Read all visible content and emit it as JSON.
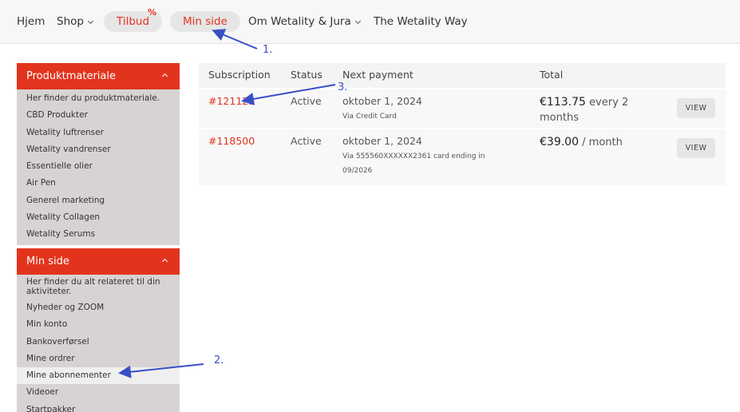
{
  "nav": {
    "items": [
      {
        "label": "Hjem"
      },
      {
        "label": "Shop"
      },
      {
        "label": "Tilbud"
      },
      {
        "label": "Min side"
      },
      {
        "label": "Om Wetality & Jura"
      },
      {
        "label": "The Wetality Way"
      }
    ],
    "tilbud_badge": "%"
  },
  "sidebar": {
    "sections": [
      {
        "title": "Produktmateriale",
        "items": [
          "Her finder du produktmateriale.",
          "CBD Produkter",
          "Wetality luftrenser",
          "Wetality vandrenser",
          "Essentielle olier",
          "Air Pen",
          "Generel marketing",
          "Wetality Collagen",
          "Wetality Serums"
        ]
      },
      {
        "title": "Min side",
        "items": [
          "Her finder du alt relateret til din aktiviteter.",
          "Nyheder og ZOOM",
          "Min konto",
          "Bankoverførsel",
          "Mine ordrer",
          "Mine abonnementer",
          "Videoer",
          "Startpakker"
        ]
      }
    ]
  },
  "table": {
    "headers": [
      "Subscription",
      "Status",
      "Next payment",
      "Total"
    ],
    "rows": [
      {
        "id": "#121121",
        "status": "Active",
        "next_payment": "oktober 1, 2024",
        "method": "Via Credit Card",
        "amount": "€113.75",
        "period": "every 2 months",
        "action": "VIEW"
      },
      {
        "id": "#118500",
        "status": "Active",
        "next_payment": "oktober 1, 2024",
        "method": "Via 555560XXXXXX2361 card ending in 09/2026",
        "amount": "€39.00",
        "period": "/ month",
        "action": "VIEW"
      }
    ]
  },
  "annotations": [
    "1.",
    "2.",
    "3."
  ],
  "colors": {
    "accent": "#e2341d",
    "annotation": "#3a4fc7"
  }
}
